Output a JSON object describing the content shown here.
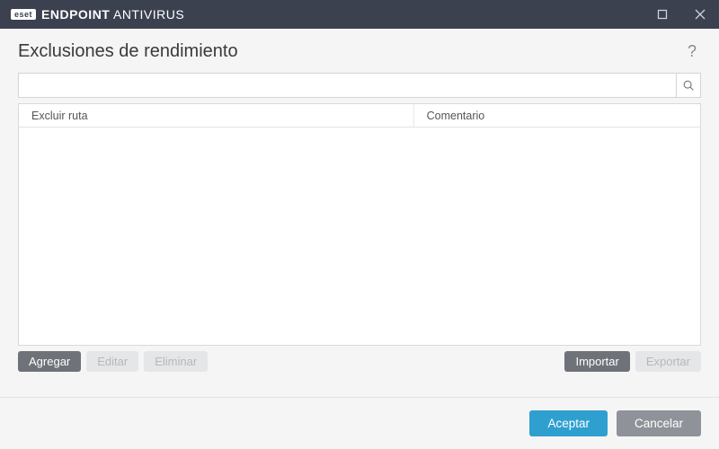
{
  "titlebar": {
    "badge": "eset",
    "name_bold": "ENDPOINT",
    "name_rest": " ANTIVIRUS"
  },
  "page": {
    "title": "Exclusiones de rendimiento",
    "help": "?"
  },
  "search": {
    "value": "",
    "placeholder": ""
  },
  "table": {
    "columns": {
      "path": "Excluir ruta",
      "comment": "Comentario"
    },
    "rows": []
  },
  "toolbar": {
    "add": "Agregar",
    "edit": "Editar",
    "delete": "Eliminar",
    "import": "Importar",
    "export": "Exportar"
  },
  "footer": {
    "ok": "Aceptar",
    "cancel": "Cancelar"
  }
}
